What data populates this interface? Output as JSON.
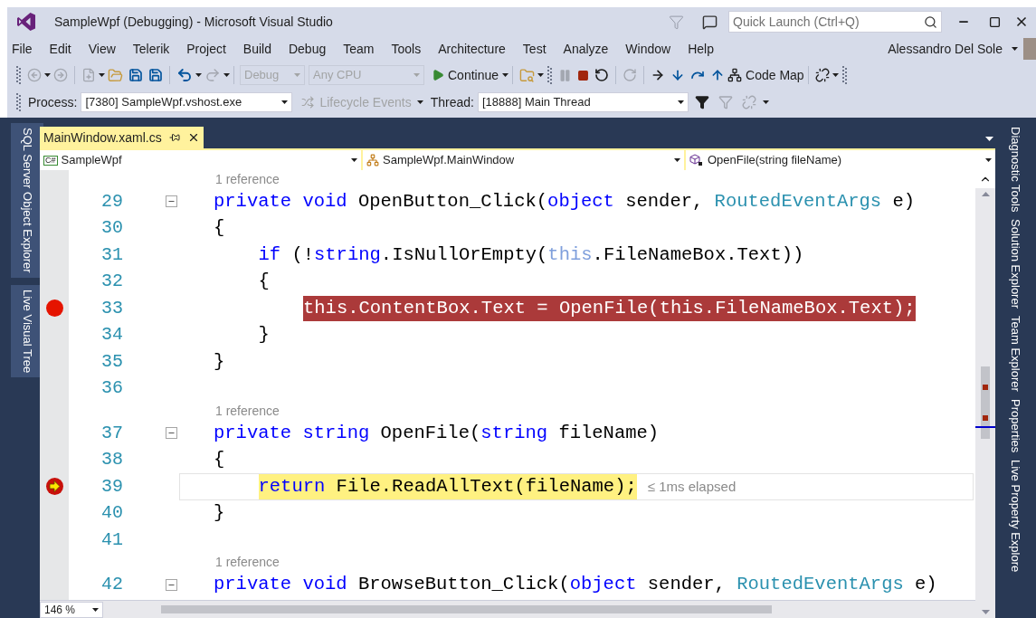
{
  "window": {
    "title": "SampleWpf (Debugging) - Microsoft Visual Studio",
    "quick_launch": {
      "placeholder": "Quick Launch (Ctrl+Q)"
    }
  },
  "menu": [
    "File",
    "Edit",
    "View",
    "Telerik",
    "Project",
    "Build",
    "Debug",
    "Team",
    "Tools",
    "Architecture",
    "Test",
    "Analyze",
    "Window",
    "Help"
  ],
  "account": {
    "name": "Alessandro Del Sole"
  },
  "toolbar": {
    "configuration": {
      "value": "Debug",
      "disabled": true
    },
    "platform": {
      "value": "Any CPU",
      "disabled": true
    },
    "continue": "Continue",
    "code_map": "Code Map"
  },
  "debug_location": {
    "process_label": "Process:",
    "process": "[7380] SampleWpf.vshost.exe",
    "lifecycle": {
      "label": "Lifecycle Events",
      "disabled": true
    },
    "thread_label": "Thread:",
    "thread": "[18888] Main Thread"
  },
  "left_panels": [
    {
      "label": "SQL Server Object Explorer"
    },
    {
      "label": "Live Visual Tree"
    }
  ],
  "right_panels": [
    {
      "label": "Diagnostic Tools"
    },
    {
      "label": "Solution Explorer"
    },
    {
      "label": "Team Explorer"
    },
    {
      "label": "Properties"
    },
    {
      "label": "Live Property Explore"
    }
  ],
  "tabs": [
    {
      "label": "MainWindow.xaml.cs",
      "selected": true
    }
  ],
  "nav": {
    "project_icon": "C#",
    "project": "SampleWpf",
    "type": "SampleWpf.MainWindow",
    "member": "OpenFile(string fileName)"
  },
  "code": {
    "lines": [
      {
        "kind": "lens",
        "text": "1 reference"
      },
      {
        "kind": "code",
        "number": "29",
        "breakpoint": false,
        "current": false,
        "collapsible": true,
        "segments": [
          {
            "text": "private",
            "kind": "keyword"
          },
          {
            "text": " void",
            "kind": "keyword"
          },
          {
            "text": " OpenButton_Click(",
            "kind": "plain"
          },
          {
            "text": "object",
            "kind": "keyword"
          },
          {
            "text": " sender, ",
            "kind": "plain"
          },
          {
            "text": "RoutedEventArgs",
            "kind": "type"
          },
          {
            "text": " e)",
            "kind": "plain"
          }
        ]
      },
      {
        "kind": "code",
        "number": "30",
        "breakpoint": false,
        "current": false,
        "collapsible": false,
        "segments": [
          {
            "text": "{",
            "kind": "plain"
          }
        ],
        "children": [
          {
            "kind": "code",
            "number": "31",
            "breakpoint": false,
            "current": false,
            "collapsible": false,
            "segments": [
              {
                "text": "if",
                "kind": "keyword"
              },
              {
                "text": " (!",
                "kind": "plain"
              },
              {
                "text": "string",
                "kind": "keyword"
              },
              {
                "text": ".IsNullOrEmpty(",
                "kind": "plain"
              },
              {
                "text": "this",
                "kind": "faded"
              },
              {
                "text": ".FileNameBox.Text))",
                "kind": "plain"
              }
            ]
          },
          {
            "kind": "code",
            "number": "32",
            "breakpoint": false,
            "current": false,
            "collapsible": false,
            "segments": [
              {
                "text": "{",
                "kind": "plain"
              }
            ],
            "children": [
              {
                "kind": "code",
                "number": "33",
                "breakpoint": true,
                "current": false,
                "collapsible": false,
                "segments": [
                  {
                    "text": "this.ContentBox.Text = OpenFile(this.FileNameBox.Text);",
                    "kind": "plain"
                  }
                ]
              }
            ]
          },
          {
            "kind": "code",
            "number": "34",
            "breakpoint": false,
            "current": false,
            "collapsible": false,
            "segments": [
              {
                "text": "}",
                "kind": "plain"
              }
            ]
          }
        ]
      },
      {
        "kind": "code",
        "number": "35",
        "breakpoint": false,
        "current": false,
        "collapsible": false,
        "segments": [
          {
            "text": "}",
            "kind": "plain"
          }
        ]
      },
      {
        "kind": "code",
        "number": "36",
        "breakpoint": false,
        "current": false,
        "collapsible": false
      },
      {
        "kind": "lens",
        "text": "1 reference"
      },
      {
        "kind": "code",
        "number": "37",
        "breakpoint": false,
        "current": false,
        "collapsible": true,
        "segments": [
          {
            "text": "private",
            "kind": "keyword"
          },
          {
            "text": " string",
            "kind": "keyword"
          },
          {
            "text": " OpenFile(",
            "kind": "plain"
          },
          {
            "text": "string",
            "kind": "keyword"
          },
          {
            "text": " fileName)",
            "kind": "plain"
          }
        ]
      },
      {
        "kind": "code",
        "number": "38",
        "breakpoint": false,
        "current": false,
        "collapsible": false,
        "segments": [
          {
            "text": "{",
            "kind": "plain"
          }
        ],
        "children": [
          {
            "kind": "code",
            "number": "39",
            "breakpoint": true,
            "current": true,
            "collapsible": false,
            "segments": [
              {
                "text": "return",
                "kind": "keyword"
              },
              {
                "text": " File.ReadAllText(fileName);",
                "kind": "plain"
              }
            ],
            "tip": "≤ 1ms elapsed"
          }
        ]
      },
      {
        "kind": "code",
        "number": "40",
        "breakpoint": false,
        "current": false,
        "collapsible": false,
        "segments": [
          {
            "text": "}",
            "kind": "plain"
          }
        ]
      },
      {
        "kind": "code",
        "number": "41",
        "breakpoint": false,
        "current": false,
        "collapsible": false
      },
      {
        "kind": "lens",
        "text": "1 reference"
      },
      {
        "kind": "code",
        "number": "42",
        "breakpoint": false,
        "current": false,
        "collapsible": true,
        "segments": [
          {
            "text": "private",
            "kind": "keyword"
          },
          {
            "text": " void",
            "kind": "keyword"
          },
          {
            "text": " BrowseButton_Click(",
            "kind": "plain"
          },
          {
            "text": "object",
            "kind": "keyword"
          },
          {
            "text": " sender, ",
            "kind": "plain"
          },
          {
            "text": "RoutedEventArgs",
            "kind": "type"
          },
          {
            "text": " e)",
            "kind": "plain"
          }
        ]
      }
    ]
  },
  "zoom": "146 %"
}
